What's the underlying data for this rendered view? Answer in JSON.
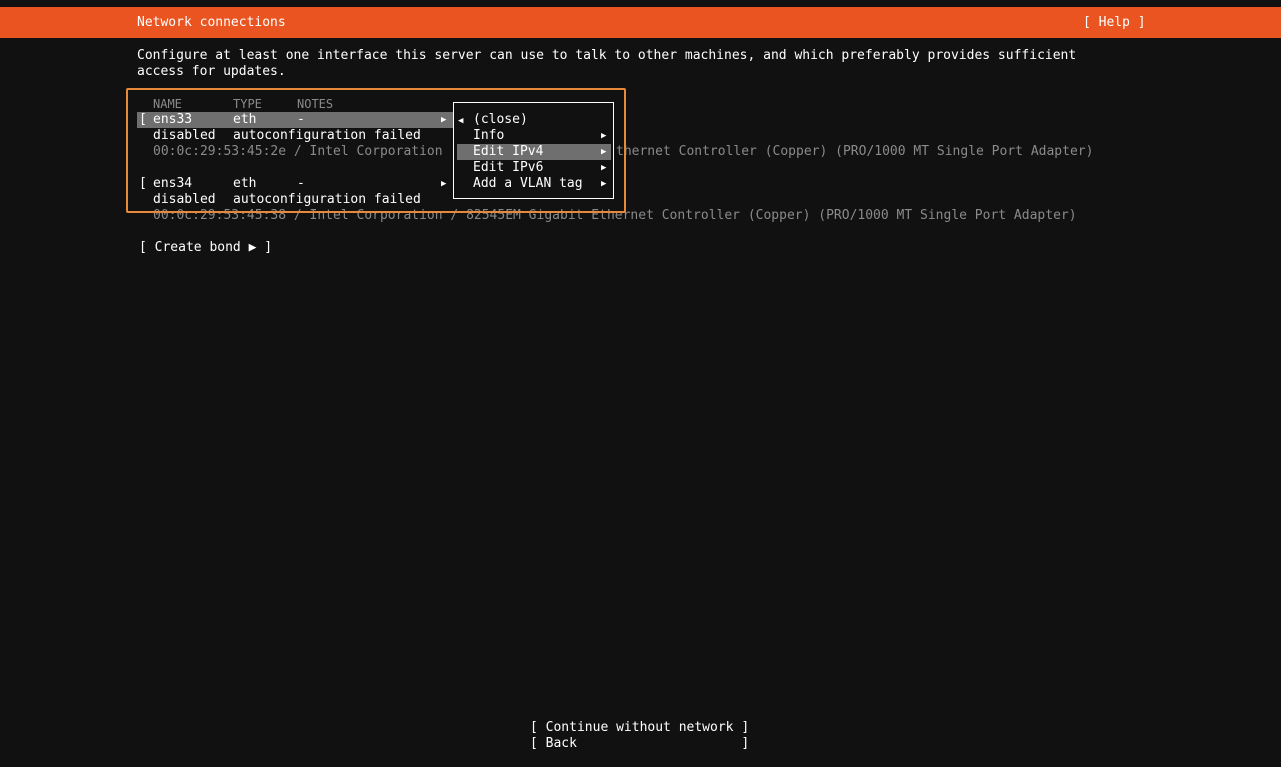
{
  "header": {
    "title": "Network connections",
    "help": "[ Help ]"
  },
  "intro": {
    "line1": "Configure at least one interface this server can use to talk to other machines, and which preferably provides sufficient",
    "line2": "access for updates."
  },
  "table": {
    "columns": [
      "NAME",
      "TYPE",
      "NOTES"
    ],
    "interfaces": [
      {
        "name": "ens33",
        "type": "eth",
        "notes": "-",
        "state": "disabled",
        "status": "autoconfiguration failed",
        "mac_vendor": "00:0c:29:53:45:2e / Intel Corporation",
        "device": "thernet Controller (Copper) (PRO/1000 MT Single Port Adapter)"
      },
      {
        "name": "ens34",
        "type": "eth",
        "notes": "-",
        "state": "disabled",
        "status": "autoconfiguration failed",
        "mac_vendor": "00:0c:29:53:45:38 / Intel Corporation / 82545EM Gigabit Ethernet Controller (Copper) (PRO/1000 MT Single Port Adapter)"
      }
    ]
  },
  "brackets": {
    "open": "[",
    "close": "]"
  },
  "create_bond": "[ Create bond ▶ ]",
  "context_menu": {
    "items": [
      {
        "label": "(close)",
        "arrow": "◀"
      },
      {
        "label": "Info",
        "arrow": "▶"
      },
      {
        "label": "Edit IPv4",
        "arrow": "▶"
      },
      {
        "label": "Edit IPv6",
        "arrow": "▶"
      },
      {
        "label": "Add a VLAN tag",
        "arrow": "▶"
      }
    ],
    "selected": "Edit IPv4"
  },
  "footer": {
    "continue": "[ Continue without network ]",
    "back": "[ Back                     ]"
  },
  "colors": {
    "header": "#e95420",
    "selection": "#6f6f6f",
    "highlight_border": "#e6893a",
    "dim_text": "#8a8a8a"
  },
  "icons": {
    "submenu": "right-triangle-icon",
    "back": "left-triangle-icon"
  }
}
